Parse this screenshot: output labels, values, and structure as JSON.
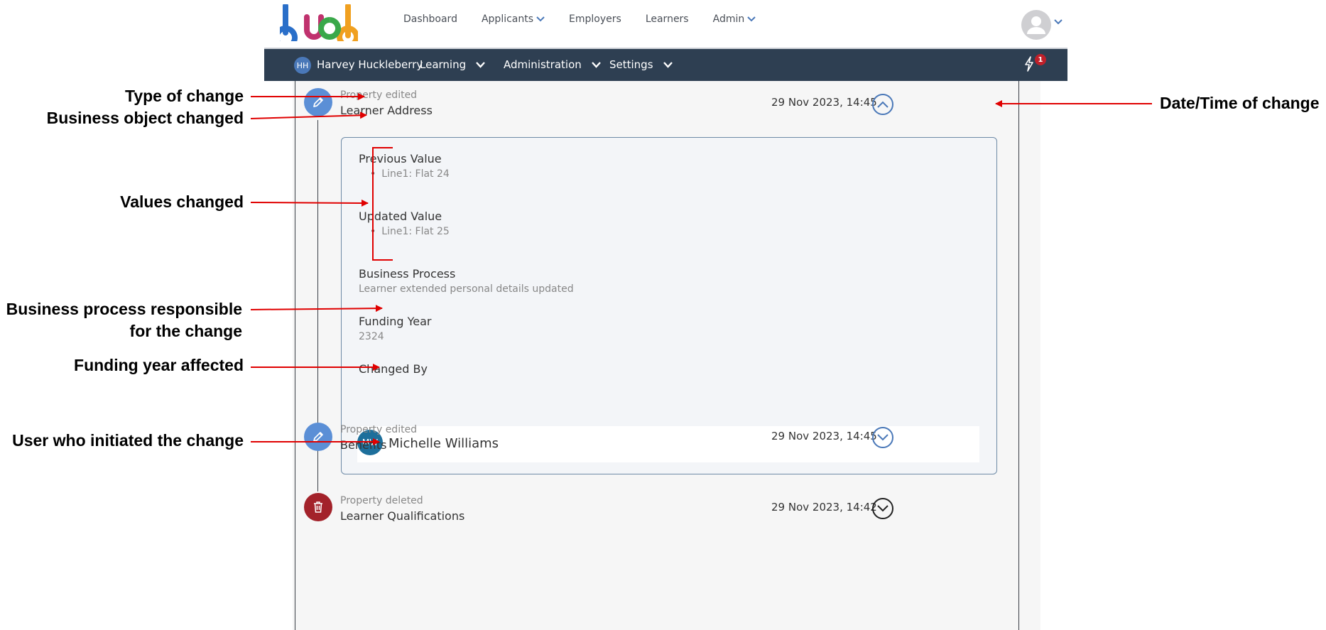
{
  "topnav": {
    "logo_text": "bud",
    "menu": [
      {
        "label": "Dashboard",
        "has_caret": false
      },
      {
        "label": "Applicants",
        "has_caret": true
      },
      {
        "label": "Employers",
        "has_caret": false
      },
      {
        "label": "Learners",
        "has_caret": false
      },
      {
        "label": "Admin",
        "has_caret": true
      }
    ]
  },
  "subnav": {
    "user_initials": "HH",
    "user_name": "Harvey Huckleberry",
    "items": [
      {
        "label": "Learning"
      },
      {
        "label": "Administration"
      },
      {
        "label": "Settings"
      }
    ],
    "notification_count": "1"
  },
  "entries": [
    {
      "type": "Property edited",
      "object": "Learner Address",
      "date": "29 Nov 2023, 14:45",
      "icon": "pencil-icon",
      "color": "#5b8fd6",
      "expanded": true
    },
    {
      "type": "Property edited",
      "object": "Benefits",
      "date": "29 Nov 2023, 14:45",
      "icon": "pencil-icon",
      "color": "#5b8fd6",
      "expanded": false
    },
    {
      "type": "Property deleted",
      "object": "Learner Qualifications",
      "date": "29 Nov 2023, 14:42",
      "icon": "trash-icon",
      "color": "#a3222a",
      "expanded": false
    }
  ],
  "details": {
    "previous_label": "Previous Value",
    "previous_items": [
      "Line1: Flat 24"
    ],
    "updated_label": "Updated Value",
    "updated_items": [
      "Line1: Flat 25"
    ],
    "process_label": "Business Process",
    "process_value": "Learner extended personal details updated",
    "funding_label": "Funding Year",
    "funding_value": "2324",
    "changed_by_label": "Changed By",
    "changed_by_initials": "MW",
    "changed_by_name": "Michelle Williams"
  },
  "annotations": {
    "type_of_change": "Type of change",
    "business_object": "Business object changed",
    "values_changed": "Values changed",
    "process_line1": "Business process responsible",
    "process_line2": "for the change",
    "funding_year": "Funding year affected",
    "user": "User who initiated the change",
    "datetime": "Date/Time of change"
  },
  "colors": {
    "subnav_bg": "#2e3f52",
    "annotation_arrow": "#e00000",
    "accent_blue": "#5b8fd6",
    "delete_red": "#a3222a"
  }
}
